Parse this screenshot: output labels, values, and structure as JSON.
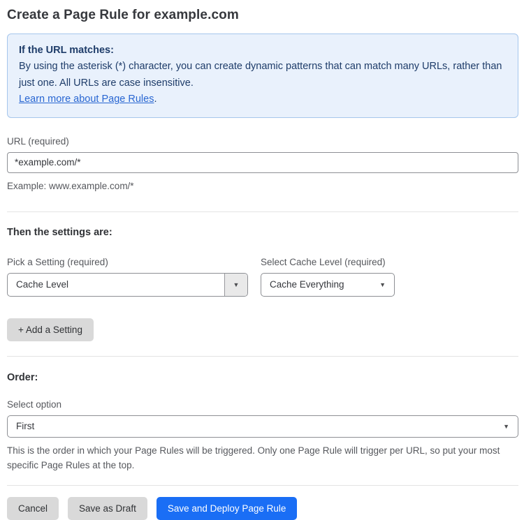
{
  "page": {
    "title": "Create a Page Rule for example.com"
  },
  "info_box": {
    "heading": "If the URL matches:",
    "body": "By using the asterisk (*) character, you can create dynamic patterns that can match many URLs, rather than just one. All URLs are case insensitive.",
    "link_text": "Learn more about Page Rules",
    "link_suffix": "."
  },
  "url_field": {
    "label": "URL (required)",
    "value": "*example.com/*",
    "helper": "Example: www.example.com/*"
  },
  "settings_section": {
    "heading": "Then the settings are:",
    "pick_setting": {
      "label": "Pick a Setting (required)",
      "selected": "Cache Level"
    },
    "cache_level": {
      "label": "Select Cache Level (required)",
      "selected": "Cache Everything"
    },
    "add_setting_label": "+ Add a Setting"
  },
  "order_section": {
    "heading": "Order:",
    "select_label": "Select option",
    "selected": "First",
    "helper": "This is the order in which your Page Rules will be triggered. Only one Page Rule will trigger per URL, so put your most specific Page Rules at the top."
  },
  "footer": {
    "cancel_label": "Cancel",
    "save_draft_label": "Save as Draft",
    "save_deploy_label": "Save and Deploy Page Rule"
  },
  "icons": {
    "dropdown_arrow": "▼"
  },
  "colors": {
    "accent_blue": "#1a6ef5",
    "info_background": "#e9f1fc",
    "info_border": "#a5c6ec",
    "info_text": "#1e3c69",
    "link_blue": "#2866d2",
    "button_gray": "#d9d9d9"
  }
}
